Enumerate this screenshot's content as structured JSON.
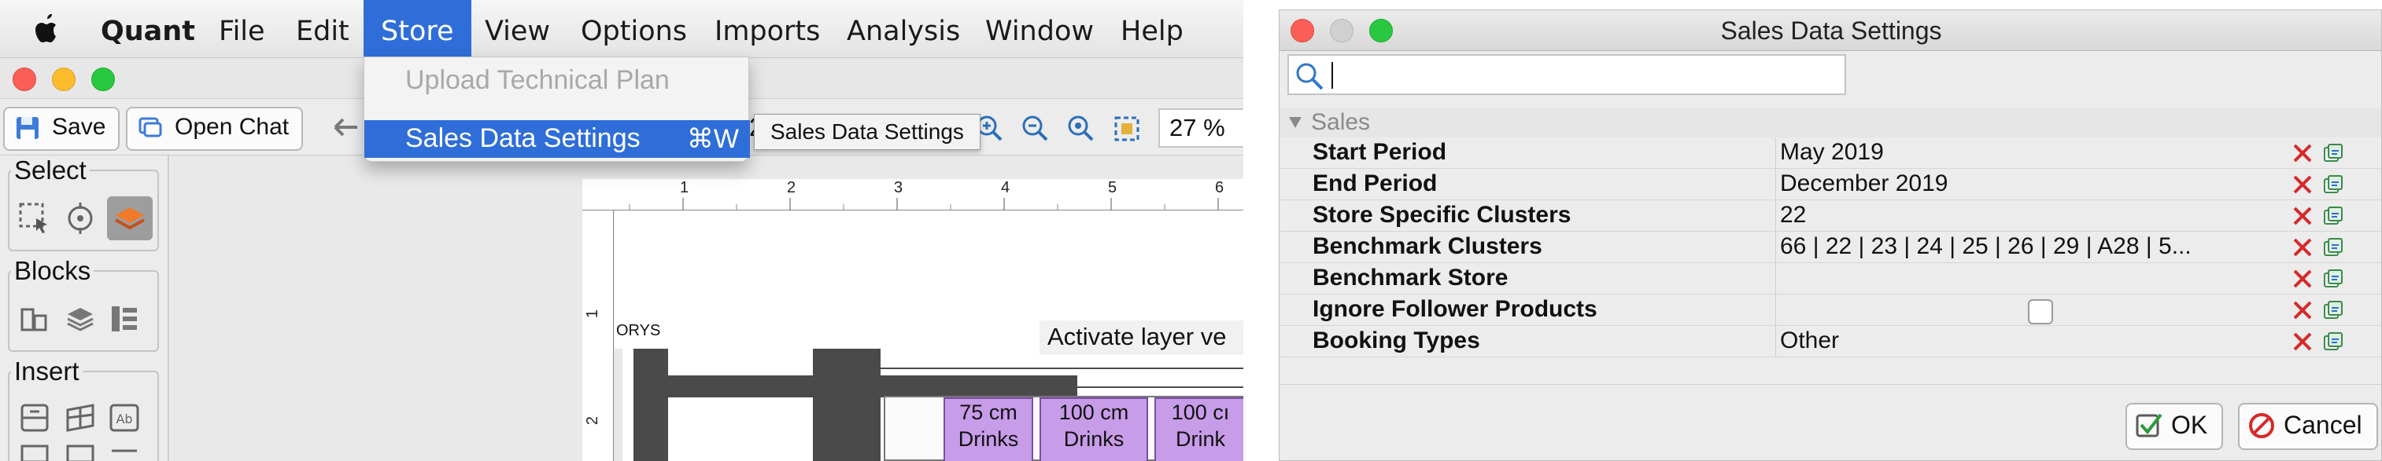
{
  "left_app": {
    "menubar": {
      "app_name": "Quant",
      "items": [
        "File",
        "Edit",
        "Store",
        "View",
        "Options",
        "Imports",
        "Analysis",
        "Window",
        "Help"
      ]
    },
    "store_menu": {
      "items": [
        {
          "label": "Upload Technical Plan",
          "enabled": false
        },
        {
          "label": "Sales Data Settings",
          "shortcut": "⌘W",
          "highlighted": true
        }
      ]
    },
    "tooltip": "Sales Data Settings",
    "toolbar": {
      "save_label": "Save",
      "open_chat_label": "Open Chat",
      "zoom_value": "27 %",
      "partial_text": "2"
    },
    "panels": {
      "select_label": "Select",
      "blocks_label": "Blocks",
      "insert_label": "Insert"
    },
    "canvas": {
      "ruler_top": [
        "1",
        "2",
        "3",
        "4",
        "5",
        "6"
      ],
      "ruler_left": [
        "1",
        "2"
      ],
      "corner_label": "ORYS",
      "banner_text": "Activate layer ve",
      "shelves": [
        {
          "top": "75 cm",
          "bottom": "Drinks"
        },
        {
          "top": "100 cm",
          "bottom": "Drinks"
        },
        {
          "top": "100 cı",
          "bottom": "Drink"
        }
      ]
    }
  },
  "dialog": {
    "title": "Sales Data Settings",
    "search_value": "",
    "section_label": "Sales",
    "properties": [
      {
        "name": "Start Period",
        "value": "May 2019"
      },
      {
        "name": "End Period",
        "value": "December 2019"
      },
      {
        "name": "Store Specific Clusters",
        "value": "22"
      },
      {
        "name": "Benchmark Clusters",
        "value": "66 | 22 | 23 | 24 | 25 | 26 | 29 | A28 | 5..."
      },
      {
        "name": "Benchmark Store",
        "value": ""
      },
      {
        "name": "Ignore Follower Products",
        "value": "",
        "checkbox": true,
        "checked": false
      },
      {
        "name": "Booking Types",
        "value": "Other"
      }
    ],
    "ok_label": "OK",
    "cancel_label": "Cancel"
  },
  "colors": {
    "menu_highlight": "#2f6ed8",
    "close_red": "#fc5f57",
    "minimize_yellow": "#fdbc2e",
    "zoom_green": "#28c840",
    "remove_red": "#d62a2a",
    "shelf_purple": "#c79ce8"
  }
}
